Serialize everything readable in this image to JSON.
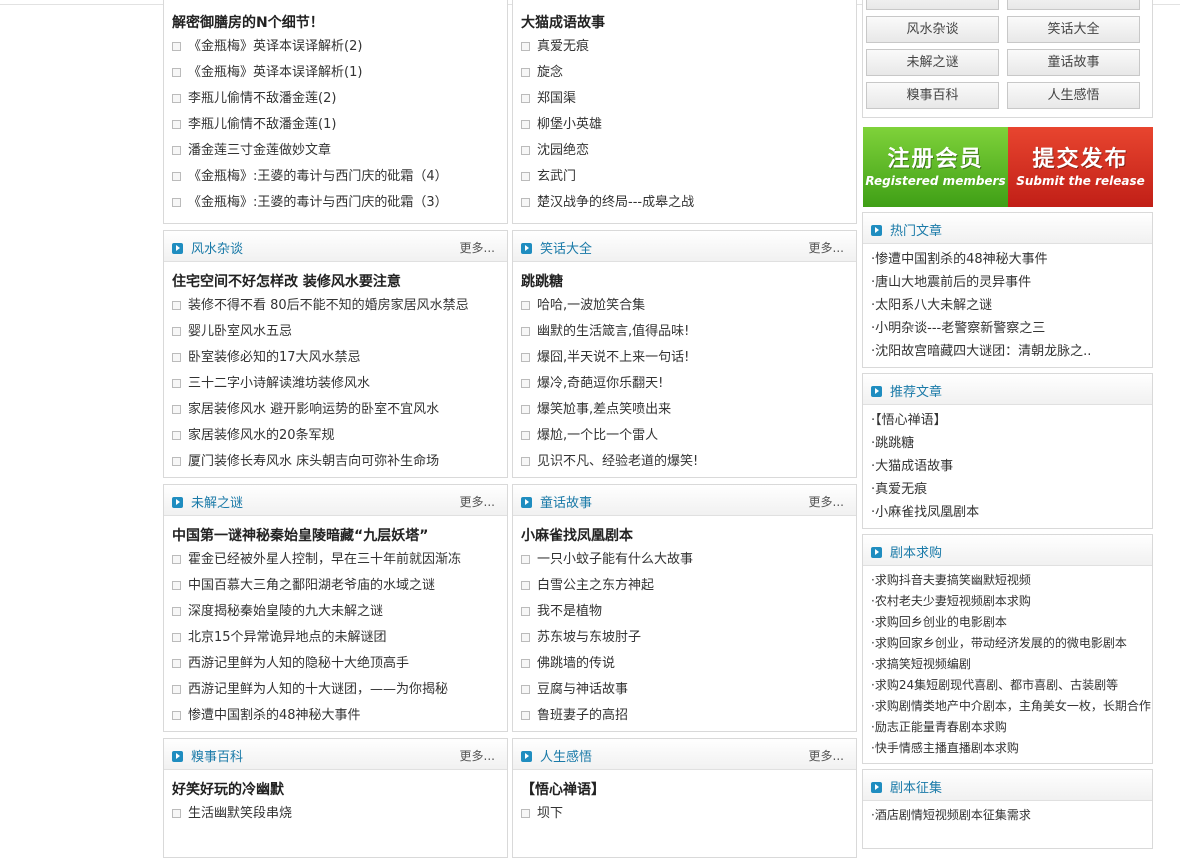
{
  "top_panels": [
    {
      "feature_title": "解密御膳房的N个细节！",
      "items": [
        "《金瓶梅》英译本误译解析(2)",
        "《金瓶梅》英译本误译解析(1)",
        "李瓶儿偷情不敌潘金莲(2)",
        "李瓶儿偷情不敌潘金莲(1)",
        "潘金莲三寸金莲做妙文章",
        "《金瓶梅》:王婆的毒计与西门庆的砒霜（4）",
        "《金瓶梅》:王婆的毒计与西门庆的砒霜（3）"
      ]
    },
    {
      "feature_title": "大猫成语故事",
      "items": [
        "真爱无痕",
        "旋念",
        "郑国渠",
        "柳堡小英雄",
        "沈园绝恋",
        "玄武门",
        "楚汉战争的终局---成皋之战"
      ]
    }
  ],
  "panels": [
    {
      "title": "风水杂谈",
      "more": "更多...",
      "feature_title": "住宅空间不好怎样改 装修风水要注意",
      "items": [
        "装修不得不看 80后不能不知的婚房家居风水禁忌",
        "婴儿卧室风水五忌",
        "卧室装修必知的17大风水禁忌",
        "三十二字小诗解读潍坊装修风水",
        "家居装修风水 避开影响运势的卧室不宜风水",
        "家居装修风水的20条军规",
        "厦门装修长寿风水 床头朝吉向可弥补生命场"
      ]
    },
    {
      "title": "笑话大全",
      "more": "更多...",
      "feature_title": "跳跳糖",
      "items": [
        "哈哈,一波尬笑合集",
        "幽默的生活箴言,值得品味!",
        "爆囧,半天说不上来一句话!",
        "爆冷,奇葩逗你乐翻天!",
        "爆笑尬事,差点笑喷出来",
        "爆尬,一个比一个雷人",
        "见识不凡、经验老道的爆笑!"
      ]
    },
    {
      "title": "未解之谜",
      "more": "更多...",
      "feature_title": "中国第一谜神秘秦始皇陵暗藏“九层妖塔”",
      "items": [
        "霍金已经被外星人控制，早在三十年前就因渐冻",
        "中国百慕大三角之鄱阳湖老爷庙的水域之谜",
        "深度揭秘秦始皇陵的九大未解之谜",
        "北京15个异常诡异地点的未解谜团",
        "西游记里鲜为人知的隐秘十大绝顶高手",
        "西游记里鲜为人知的十大谜团，——为你揭秘",
        "惨遭中国割杀的48神秘大事件"
      ]
    },
    {
      "title": "童话故事",
      "more": "更多...",
      "feature_title": "小麻雀找凤凰剧本",
      "items": [
        "一只小蚊子能有什么大故事",
        "白雪公主之东方神起",
        "我不是植物",
        "苏东坡与东坡肘子",
        "佛跳墙的传说",
        "豆腐与神话故事",
        "鲁班妻子的高招"
      ]
    },
    {
      "title": "糗事百科",
      "more": "更多...",
      "feature_title": "好笑好玩的冷幽默",
      "items": [
        "生活幽默笑段串烧"
      ]
    },
    {
      "title": "人生感悟",
      "more": "更多...",
      "feature_title": "【悟心禅语】",
      "items": [
        "坝下"
      ]
    }
  ],
  "categories": [
    "风水杂谈",
    "笑话大全",
    "未解之谜",
    "童话故事",
    "糗事百科",
    "人生感悟"
  ],
  "banner": {
    "left_cn": "注册会员",
    "left_en": "Registered members",
    "right_cn": "提交发布",
    "right_en": "Submit the release"
  },
  "sidebar": {
    "hot": {
      "title": "热门文章",
      "items": [
        "·惨遭中国割杀的48神秘大事件",
        "·唐山大地震前后的灵异事件",
        "·太阳系八大未解之谜",
        "·小明杂谈---老警察新警察之三",
        "·沈阳故宫暗藏四大谜团：清朝龙脉之.."
      ]
    },
    "recommended": {
      "title": "推荐文章",
      "items": [
        "·【悟心禅语】",
        "·跳跳糖",
        "·大猫成语故事",
        "·真爱无痕",
        "·小麻雀找凤凰剧本"
      ]
    },
    "script_wanted": {
      "title": "剧本求购",
      "items": [
        "·求购抖音夫妻搞笑幽默短视频",
        "·农村老夫少妻短视频剧本求购",
        "·求购回乡创业的电影剧本",
        "·求购回家乡创业，带动经济发展的的微电影剧本",
        "·求搞笑短视频编剧",
        "·求购24集短剧现代喜剧、都市喜剧、古装剧等",
        "·求购剧情类地产中介剧本，主角美女一枚，长期合作",
        "·励志正能量青春剧本求购",
        "·快手情感主播直播剧本求购"
      ]
    },
    "script_call": {
      "title": "剧本征集",
      "items": [
        "·酒店剧情短视频剧本征集需求"
      ]
    }
  },
  "colors": {
    "accent": "#1a7aa8",
    "icon": "#1f8dc0",
    "banner_green": "#4aa81c",
    "banner_red": "#d42a1f"
  }
}
